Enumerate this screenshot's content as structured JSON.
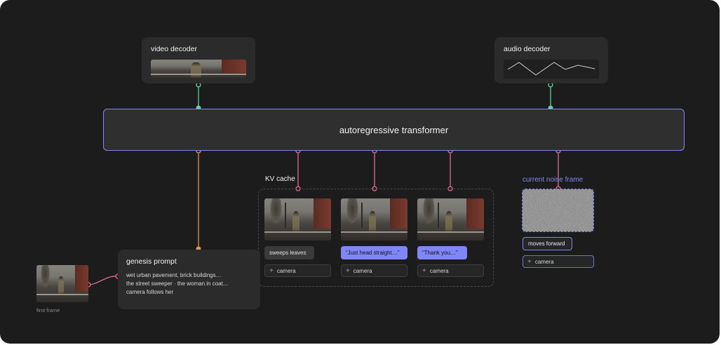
{
  "colors": {
    "background": "#1c1c1c",
    "panel": "#2b2b2b",
    "accent_purple": "#8186f7",
    "wire_green": "#5fd39a",
    "wire_pink": "#e56a93",
    "wire_orange": "#e0944e"
  },
  "video_decoder": {
    "title": "video decoder"
  },
  "audio_decoder": {
    "title": "audio decoder"
  },
  "transformer": {
    "label": "autoregressive transformer"
  },
  "kv_cache": {
    "label": "KV cache",
    "frames": [
      {
        "caption": "sweeps leaves",
        "style": "gray",
        "camera": "camera"
      },
      {
        "caption": "“Just head straight…”",
        "style": "blue",
        "camera": "camera"
      },
      {
        "caption": "“Thank you…”",
        "style": "blue",
        "camera": "camera"
      }
    ]
  },
  "current_noise": {
    "label": "current noise frame",
    "caption": "moves forward",
    "camera": "camera"
  },
  "genesis": {
    "title": "genesis prompt",
    "line1": "wet urban pavement, brick buildings…",
    "line2": "the street sweeper · the woman in coat…",
    "line3": "camera follows her"
  },
  "first_frame": {
    "label": "first frame"
  }
}
